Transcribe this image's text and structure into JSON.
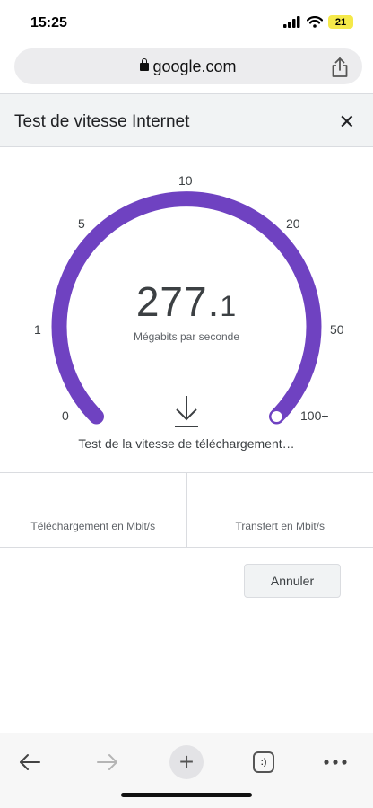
{
  "status_bar": {
    "time": "15:25",
    "battery": "21"
  },
  "browser": {
    "url": "google.com"
  },
  "widget": {
    "title": "Test de vitesse Internet",
    "close_label": "✕",
    "gauge": {
      "ticks": {
        "t0": "0",
        "t1": "1",
        "t5": "5",
        "t10": "10",
        "t20": "20",
        "t50": "50",
        "t100": "100+"
      },
      "speed_int": "277.",
      "speed_dec": "1",
      "unit": "Mégabits par seconde",
      "status": "Test de la vitesse de téléchargement…",
      "progress_fraction": 1.0,
      "accent": "#6f42c1"
    },
    "results": {
      "download_label": "Téléchargement en Mbit/s",
      "upload_label": "Transfert en Mbit/s"
    },
    "cancel_label": "Annuler"
  },
  "toolbar": {
    "icons": [
      "back-arrow-icon",
      "forward-arrow-icon",
      "new-tab-plus-icon",
      "tabs-icon",
      "more-options-icon"
    ],
    "tabs_glyph": ":)"
  }
}
